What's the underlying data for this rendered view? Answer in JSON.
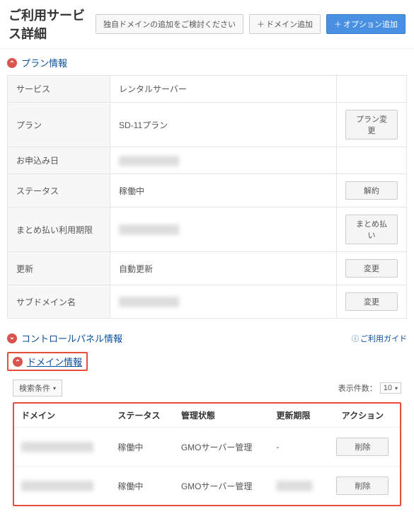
{
  "header": {
    "title": "ご利用サービス詳細",
    "suggest_domain": "独自ドメインの追加をご検討ください",
    "add_domain": "ドメイン追加",
    "add_option": "オプション追加"
  },
  "plan_section": {
    "title": "プラン情報",
    "rows": [
      {
        "label": "サービス",
        "value": "レンタルサーバー",
        "action": ""
      },
      {
        "label": "プラン",
        "value": "SD-11プラン",
        "action": "プラン変更"
      },
      {
        "label": "お申込み日",
        "value": "",
        "action": ""
      },
      {
        "label": "ステータス",
        "value": "稼働中",
        "action": "解約"
      },
      {
        "label": "まとめ払い利用期限",
        "value": "",
        "action": "まとめ払い"
      },
      {
        "label": "更新",
        "value": "自動更新",
        "action": "変更"
      },
      {
        "label": "サブドメイン名",
        "value": "",
        "action": "変更"
      }
    ]
  },
  "cp_section": {
    "title": "コントロールパネル情報",
    "guide": "ご利用ガイド"
  },
  "domain_section": {
    "title": "ドメイン情報",
    "search": "検索条件",
    "count_label": "表示件数：",
    "count_value": "10",
    "columns": {
      "domain": "ドメイン",
      "status": "ステータス",
      "mgmt": "管理状態",
      "expire": "更新期限",
      "action": "アクション"
    },
    "rows": [
      {
        "domain": "",
        "status": "稼働中",
        "mgmt": "GMOサーバー管理",
        "expire": "-",
        "action": "削除"
      },
      {
        "domain": "",
        "status": "稼働中",
        "mgmt": "GMOサーバー管理",
        "expire": "",
        "action": "削除"
      }
    ]
  }
}
